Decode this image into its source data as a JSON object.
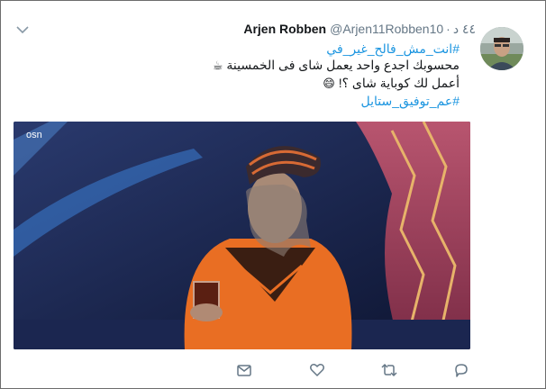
{
  "tweet": {
    "display_name": "Arjen Robben",
    "handle": "@Arjen11Robben10",
    "separator": "·",
    "time": "٤٤ د",
    "hashtag_top": "#انت_مش_فالح_غير_في",
    "line1": "محسوبك اجدع واحد يعمل شاى فى الخمسينة",
    "line1_emoji": "☕",
    "line2": "أعمل لك كوباية شاى ؟!",
    "line2_emoji": "😄",
    "hashtag_bottom": "#عم_توفيق_ستايل",
    "media_logo": "osn"
  },
  "icons": {
    "caret": "chevron-down-icon",
    "reply": "reply-icon",
    "retweet": "retweet-icon",
    "like": "heart-icon",
    "dm": "envelope-icon"
  },
  "colors": {
    "link": "#1b95e0",
    "muted": "#657786",
    "icon": "#657786"
  }
}
